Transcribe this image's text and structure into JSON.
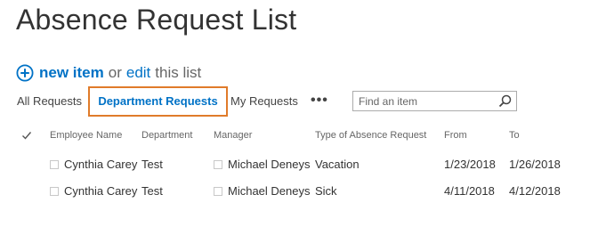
{
  "page": {
    "title": "Absence Request List"
  },
  "actions": {
    "new_item": "new item",
    "or": "or",
    "edit": "edit",
    "this_list": "this list"
  },
  "views": {
    "all": "All Requests",
    "department": "Department Requests",
    "my": "My Requests",
    "more": "•••",
    "selected": "Department Requests"
  },
  "search": {
    "placeholder": "Find an item"
  },
  "table": {
    "columns": [
      "Employee Name",
      "Department",
      "Manager",
      "Type of Absence Request",
      "From",
      "To"
    ],
    "rows": [
      {
        "employee": "Cynthia Carey",
        "department": "Test",
        "manager": "Michael Deneys",
        "type": "Vacation",
        "from": "1/23/2018",
        "to": "1/26/2018"
      },
      {
        "employee": "Cynthia Carey",
        "department": "Test",
        "manager": "Michael Deneys",
        "type": "Sick",
        "from": "4/11/2018",
        "to": "4/12/2018"
      }
    ]
  },
  "colors": {
    "accent": "#0072c6",
    "selected_border": "#e07b2a",
    "text": "#333333",
    "muted": "#666666"
  }
}
